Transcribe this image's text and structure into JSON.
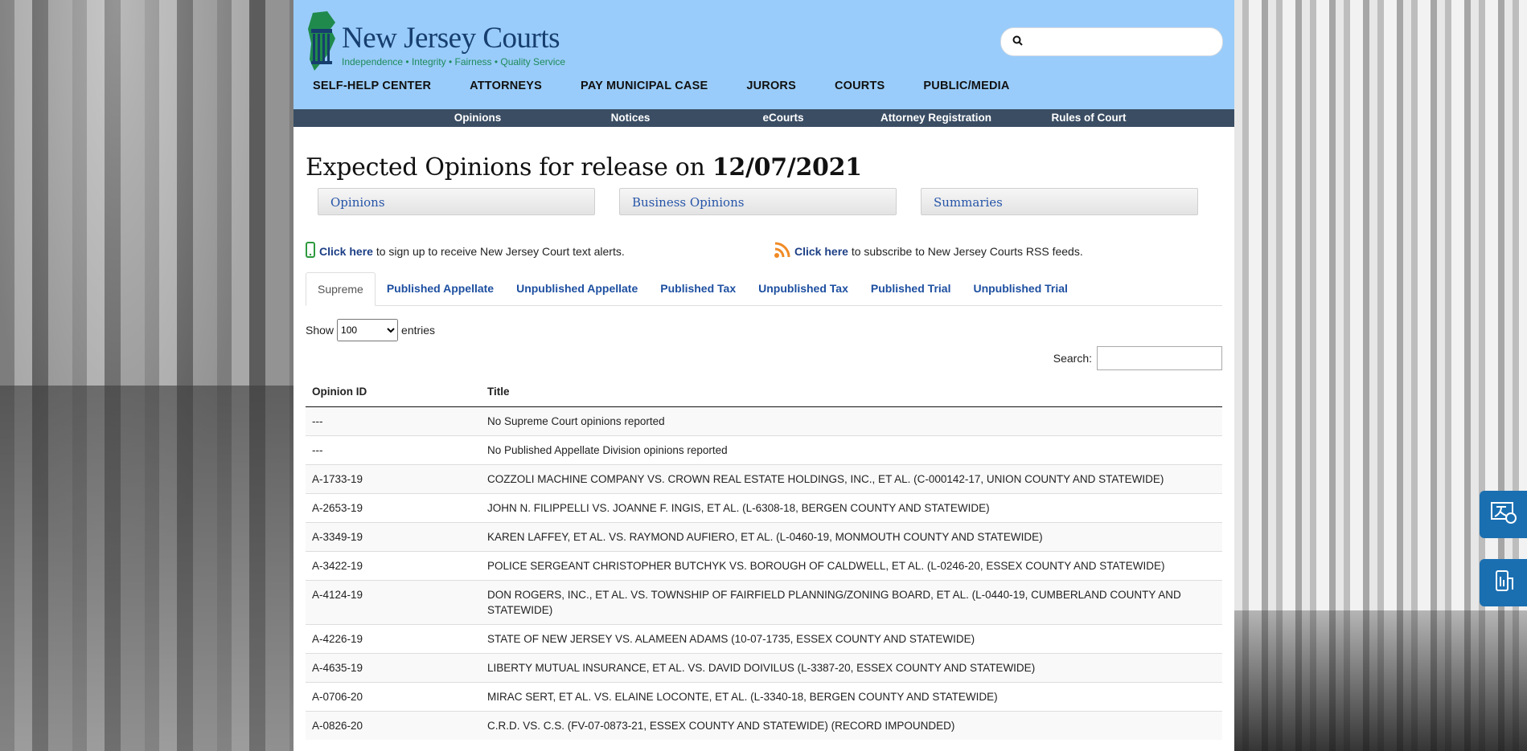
{
  "header": {
    "logo_title": "New Jersey Courts",
    "logo_tagline": "Independence • Integrity • Fairness • Quality Service",
    "search_placeholder": ""
  },
  "main_nav": [
    "SELF-HELP CENTER",
    "ATTORNEYS",
    "PAY MUNICIPAL CASE",
    "JURORS",
    "COURTS",
    "PUBLIC/MEDIA"
  ],
  "sub_nav": [
    "Opinions",
    "Notices",
    "eCourts",
    "Attorney Registration",
    "Rules of Court"
  ],
  "page": {
    "title_prefix": "Expected Opinions for release on",
    "title_date": "12/07/2021"
  },
  "buttons": [
    "Opinions",
    "Business Opinions",
    "Summaries"
  ],
  "alerts": {
    "text_link": "Click here",
    "text_rest": "to sign up to receive New Jersey Court text alerts.",
    "rss_link": "Click here",
    "rss_rest": "to subscribe to New Jersey Courts RSS feeds."
  },
  "tabs": [
    {
      "label": "Supreme",
      "active": true
    },
    {
      "label": "Published Appellate",
      "active": false
    },
    {
      "label": "Unpublished Appellate",
      "active": false
    },
    {
      "label": "Published Tax",
      "active": false
    },
    {
      "label": "Unpublished Tax",
      "active": false
    },
    {
      "label": "Published Trial",
      "active": false
    },
    {
      "label": "Unpublished Trial",
      "active": false
    }
  ],
  "table_controls": {
    "show_label": "Show",
    "entries_label": "entries",
    "page_size": "100",
    "search_label": "Search:"
  },
  "table": {
    "columns": [
      "Opinion ID",
      "Title"
    ],
    "rows": [
      [
        "---",
        "No Supreme Court opinions reported"
      ],
      [
        "---",
        "No Published Appellate Division opinions reported"
      ],
      [
        "A-1733-19",
        "COZZOLI MACHINE COMPANY VS. CROWN REAL ESTATE HOLDINGS, INC., ET AL. (C-000142-17, UNION COUNTY AND STATEWIDE)"
      ],
      [
        "A-2653-19",
        "JOHN N. FILIPPELLI VS. JOANNE F. INGIS, ET AL. (L-6308-18, BERGEN COUNTY AND STATEWIDE)"
      ],
      [
        "A-3349-19",
        "KAREN LAFFEY, ET AL. VS. RAYMOND AUFIERO, ET AL. (L-0460-19, MONMOUTH COUNTY AND STATEWIDE)"
      ],
      [
        "A-3422-19",
        "POLICE SERGEANT CHRISTOPHER BUTCHYK VS. BOROUGH OF CALDWELL, ET AL. (L-0246-20, ESSEX COUNTY AND STATEWIDE)"
      ],
      [
        "A-4124-19",
        "DON ROGERS, INC., ET AL. VS. TOWNSHIP OF FAIRFIELD PLANNING/ZONING BOARD, ET AL. (L-0440-19, CUMBERLAND COUNTY AND STATEWIDE)"
      ],
      [
        "A-4226-19",
        "STATE OF NEW JERSEY VS. ALAMEEN ADAMS (10-07-1735, ESSEX COUNTY AND STATEWIDE)"
      ],
      [
        "A-4635-19",
        "LIBERTY MUTUAL INSURANCE, ET AL. VS. DAVID DOIVILUS (L-3387-20, ESSEX COUNTY AND STATEWIDE)"
      ],
      [
        "A-0706-20",
        "MIRAC SERT, ET AL. VS. ELAINE LOCONTE, ET AL. (L-3340-18, BERGEN COUNTY AND STATEWIDE)"
      ],
      [
        "A-0826-20",
        "C.R.D. VS. C.S. (FV-07-0873-21, ESSEX COUNTY AND STATEWIDE) (RECORD IMPOUNDED)"
      ]
    ]
  },
  "colors": {
    "header_bg": "#99ccfa",
    "subnav_bg": "#3a4d63",
    "link": "#1d4fa0",
    "float_button": "#1a6fb1"
  },
  "icons": {
    "search": "magnifier-icon",
    "phone": "mobile-phone-icon",
    "rss": "rss-icon",
    "float_1": "language-translate-icon",
    "float_2": "accessibility-icon"
  }
}
